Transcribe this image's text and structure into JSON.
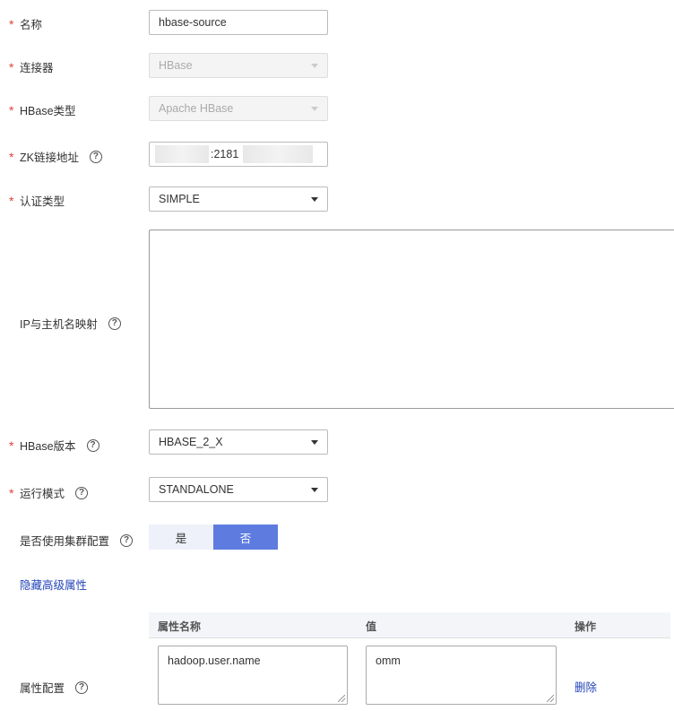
{
  "form": {
    "name": {
      "label": "名称",
      "value": "hbase-source"
    },
    "connector": {
      "label": "连接器",
      "value": "HBase"
    },
    "hbase_type": {
      "label": "HBase类型",
      "value": "Apache HBase"
    },
    "zk_address": {
      "label": "ZK链接地址",
      "value": ":2181"
    },
    "auth_type": {
      "label": "认证类型",
      "value": "SIMPLE"
    },
    "ip_mapping": {
      "label": "IP与主机名映射",
      "value": ""
    },
    "hbase_version": {
      "label": "HBase版本",
      "value": "HBASE_2_X"
    },
    "run_mode": {
      "label": "运行模式",
      "value": "STANDALONE"
    },
    "use_cluster_config": {
      "label": "是否使用集群配置",
      "options": [
        "是",
        "否"
      ],
      "selected": "否"
    },
    "required_mark": "*",
    "help_glyph": "?"
  },
  "advanced_link": "隐藏高级属性",
  "properties": {
    "label": "属性配置",
    "columns": [
      "属性名称",
      "值",
      "操作"
    ],
    "rows": [
      {
        "name": "hadoop.user.name",
        "value": "omm",
        "action": "删除"
      }
    ]
  },
  "colors": {
    "accent": "#5e7ce0",
    "required": "#e0423a",
    "link": "#2243b8"
  }
}
